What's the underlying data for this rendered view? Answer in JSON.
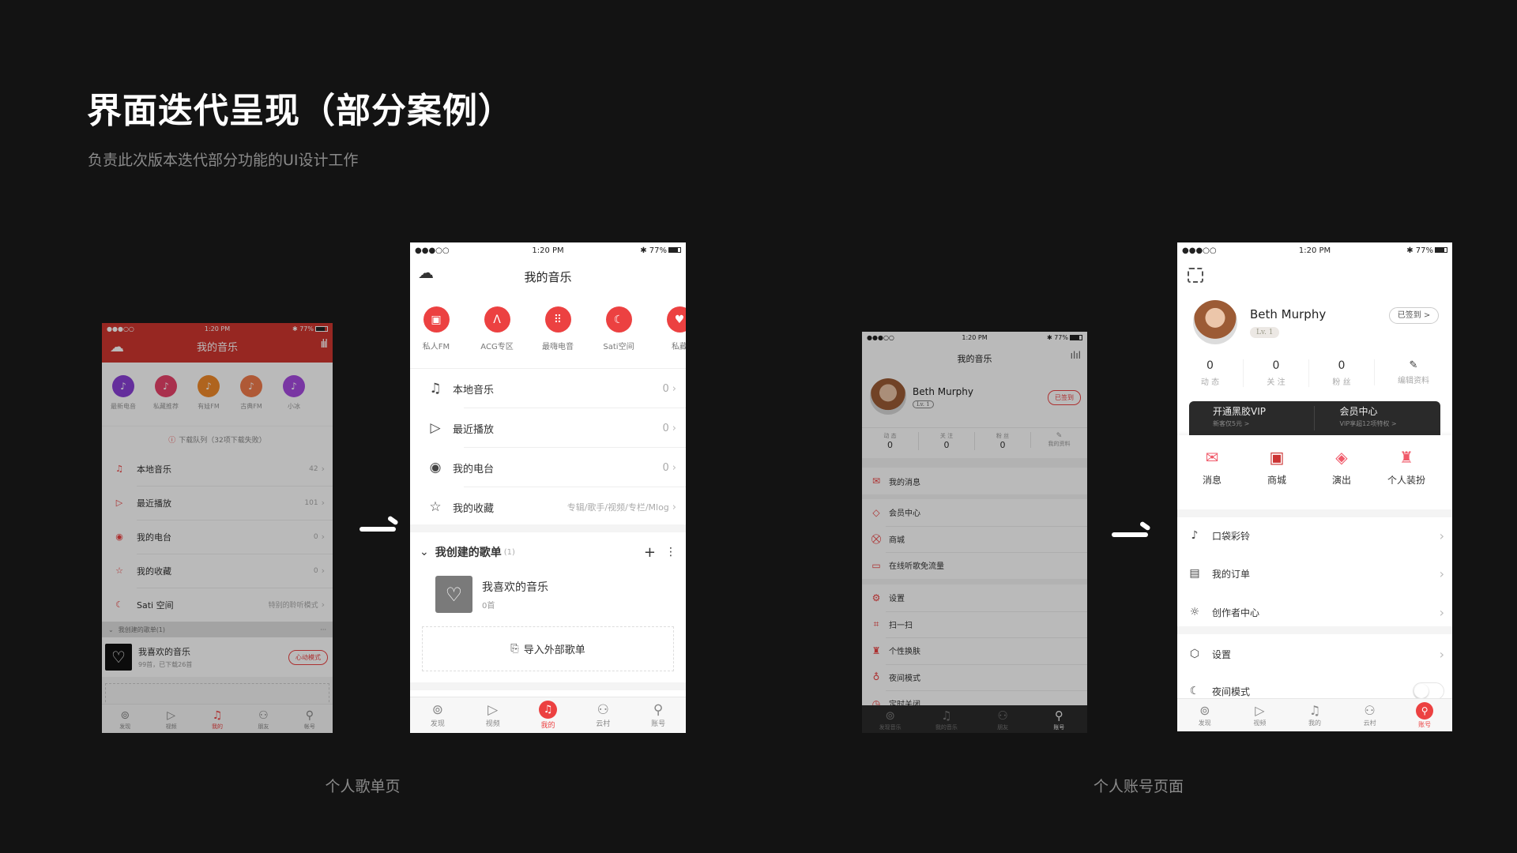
{
  "page": {
    "title": "界面迭代呈现（部分案例）",
    "subtitle": "负责此次版本迭代部分功能的UI设计工作",
    "caption_left": "个人歌单页",
    "caption_right": "个人账号页面"
  },
  "colors": {
    "accent": "#ec4141",
    "background": "#131313",
    "old_header": "#d0362f"
  },
  "status_bar": {
    "signal": "●●●○○",
    "time": "1:20 PM",
    "battery": "77%"
  },
  "old_playlist": {
    "title": "我的音乐",
    "shortcuts": [
      {
        "label": "最新电音",
        "color": "#8a3fd6",
        "icon": "dj-icon"
      },
      {
        "label": "私藏推荐",
        "color": "#e8436a",
        "icon": "sound-wave-icon"
      },
      {
        "label": "有娃FM",
        "color": "#f08a2a",
        "icon": "baby-icon"
      },
      {
        "label": "古典FM",
        "color": "#f07a4a",
        "icon": "piano-icon"
      },
      {
        "label": "小冰",
        "color": "#a64be0",
        "icon": "bot-icon"
      }
    ],
    "download_notice": "下载队列（32项下载失败）",
    "rows": [
      {
        "label": "本地音乐",
        "value": "42",
        "icon": "♫"
      },
      {
        "label": "最近播放",
        "value": "101",
        "icon": "▷"
      },
      {
        "label": "我的电台",
        "value": "0",
        "icon": "◉"
      },
      {
        "label": "我的收藏",
        "value": "0",
        "icon": "☆"
      },
      {
        "label": "Sati 空间",
        "value": "特别的聆听模式",
        "icon": "☾"
      }
    ],
    "section": "我创建的歌单(1)",
    "section_more": "···",
    "playlist": {
      "name": "我喜欢的音乐",
      "meta": "99首，已下载26首",
      "button": "心动模式"
    },
    "tabs": [
      "发现",
      "视频",
      "我的",
      "朋友",
      "帐号"
    ],
    "active_tab": 2
  },
  "new_playlist": {
    "title": "我的音乐",
    "shortcuts": [
      "私人FM",
      "ACG专区",
      "最嗨电音",
      "Sati空间",
      "私藏"
    ],
    "rows": [
      {
        "label": "本地音乐",
        "value": "0",
        "icon": "♫"
      },
      {
        "label": "最近播放",
        "value": "0",
        "icon": "▷"
      },
      {
        "label": "我的电台",
        "value": "0",
        "icon": "◉"
      },
      {
        "label": "我的收藏",
        "value": "专辑/歌手/视频/专栏/Mlog",
        "icon": "☆"
      }
    ],
    "section_title": "我创建的歌单",
    "section_count": "(1)",
    "playlist": {
      "name": "我喜欢的音乐",
      "meta": "0首"
    },
    "import_label": "导入外部歌单",
    "tabs": [
      "发现",
      "视频",
      "我的",
      "云村",
      "账号"
    ],
    "active_tab": 2
  },
  "old_account": {
    "title": "我的音乐",
    "user": {
      "name": "Beth Murphy",
      "level": "Lv. 1",
      "checkin": "已签到"
    },
    "stats": [
      {
        "label": "动 态",
        "value": "0"
      },
      {
        "label": "关 注",
        "value": "0"
      },
      {
        "label": "粉 丝",
        "value": "0"
      }
    ],
    "edit_label": "我的资料",
    "groups": [
      [
        {
          "label": "我的消息",
          "icon": "✉"
        }
      ],
      [
        {
          "label": "会员中心",
          "icon": "◇"
        },
        {
          "label": "商城",
          "icon": "⛒"
        },
        {
          "label": "在线听歌免流量",
          "icon": "▭"
        }
      ],
      [
        {
          "label": "设置",
          "icon": "⚙"
        },
        {
          "label": "扫一扫",
          "icon": "⌗"
        },
        {
          "label": "个性换肤",
          "icon": "♜"
        },
        {
          "label": "夜间模式",
          "icon": "♁"
        },
        {
          "label": "定时关闭",
          "icon": "◷"
        }
      ]
    ],
    "tabs": [
      "发现音乐",
      "我的音乐",
      "朋友",
      "账号"
    ],
    "active_tab": 3
  },
  "new_account": {
    "user": {
      "name": "Beth Murphy",
      "level": "Lv. 1",
      "checkin": "已签到 >"
    },
    "stats": [
      {
        "label": "动 态",
        "value": "0"
      },
      {
        "label": "关 注",
        "value": "0"
      },
      {
        "label": "粉 丝",
        "value": "0"
      }
    ],
    "edit_label": "编辑资料",
    "vip": {
      "title": "开通黑胶VIP",
      "sub": "新客仅5元 >"
    },
    "member": {
      "title": "会员中心",
      "sub": "VIP享超12项特权 >"
    },
    "quick": [
      {
        "label": "消息",
        "icon": "✉"
      },
      {
        "label": "商城",
        "icon": "▣"
      },
      {
        "label": "演出",
        "icon": "◈"
      },
      {
        "label": "个人装扮",
        "icon": "♜"
      }
    ],
    "groups": [
      [
        {
          "label": "口袋彩铃",
          "icon": "♪"
        },
        {
          "label": "我的订单",
          "icon": "▤"
        },
        {
          "label": "创作者中心",
          "icon": "☼"
        }
      ],
      [
        {
          "label": "设置",
          "icon": "⬡"
        },
        {
          "label": "夜间模式",
          "icon": "☾",
          "toggle": false
        }
      ]
    ],
    "tabs": [
      "发现",
      "视频",
      "我的",
      "云村",
      "账号"
    ],
    "active_tab": 4
  }
}
